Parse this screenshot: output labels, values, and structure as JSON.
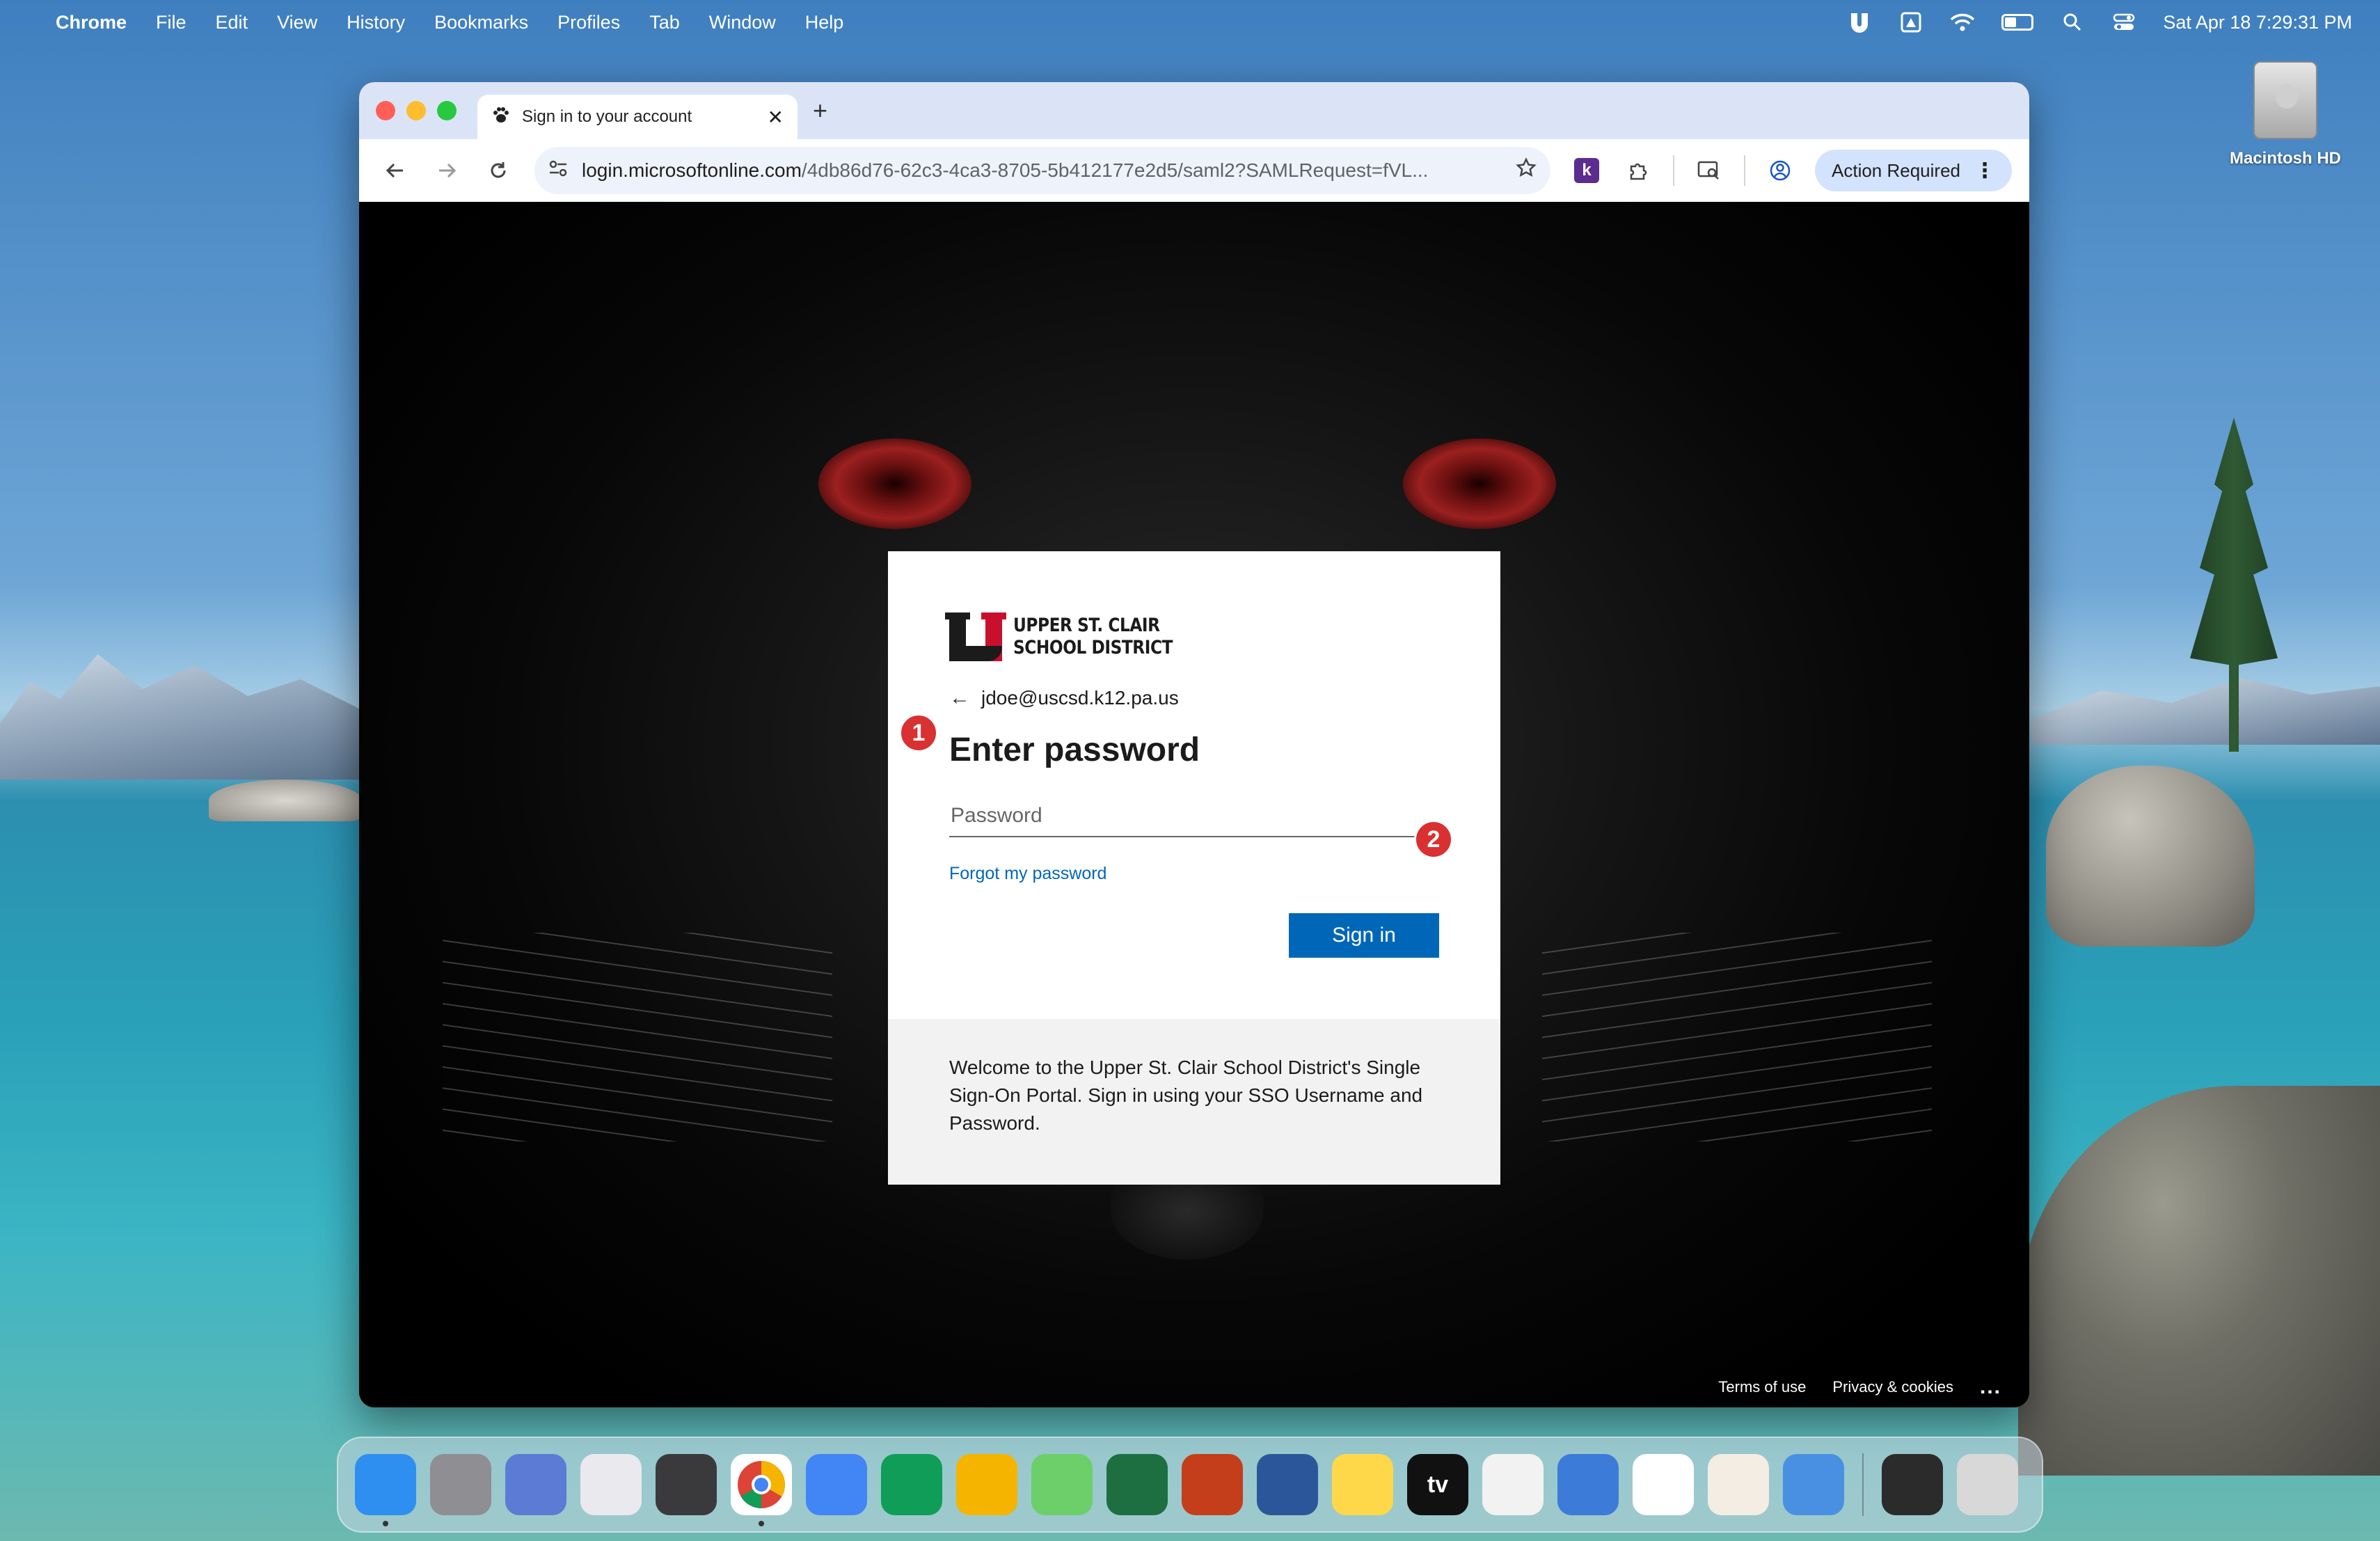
{
  "menubar": {
    "apple": "",
    "app_name": "Chrome",
    "items": [
      "File",
      "Edit",
      "View",
      "History",
      "Bookmarks",
      "Profiles",
      "Tab",
      "Window",
      "Help"
    ],
    "clock": "Sat Apr 18  7:29:31 PM",
    "status_icons": [
      "u-icon",
      "drive-icon",
      "wifi-icon",
      "battery-icon",
      "search-icon",
      "control-center-icon"
    ]
  },
  "desktop": {
    "hd_label": "Macintosh HD"
  },
  "browser": {
    "tab_title": "Sign in to your account",
    "tab_close": "✕",
    "new_tab": "+",
    "url_host": "login.microsoftonline.com",
    "url_path": "/4db86d76-62c3-4ca3-8705-5b412177e2d5/saml2?SAMLRequest=fVL...",
    "ext_k": "k",
    "action_required": "Action Required"
  },
  "signin": {
    "logo_line1": "UPPER ST. CLAIR",
    "logo_line2": "SCHOOL DISTRICT",
    "back_arrow": "←",
    "identity": "jdoe@uscsd.k12.pa.us",
    "heading": "Enter password",
    "password_placeholder": "Password",
    "forgot_link": "Forgot my password",
    "signin_button": "Sign in",
    "footer_text": "Welcome to the Upper St. Clair School District's Single Sign-On Portal. Sign in using your SSO Username and Password."
  },
  "annotations": {
    "badge_1": "1",
    "badge_2": "2"
  },
  "page_footer": {
    "terms": "Terms of use",
    "privacy": "Privacy & cookies",
    "more": "..."
  },
  "dock": {
    "apps": [
      {
        "name": "finder",
        "color": "#2f8ff0",
        "running": true
      },
      {
        "name": "system-settings",
        "color": "#8e8e93",
        "running": false
      },
      {
        "name": "iphone-mirroring",
        "color": "#5b7bd5",
        "running": false
      },
      {
        "name": "launchpad",
        "color": "#e9e9ee",
        "running": false
      },
      {
        "name": "calculator",
        "color": "#3a3a3c",
        "running": false
      },
      {
        "name": "chrome",
        "color": "#ffffff",
        "running": true
      },
      {
        "name": "google-docs",
        "color": "#4285f4",
        "running": false
      },
      {
        "name": "google-sheets",
        "color": "#0f9d58",
        "running": false
      },
      {
        "name": "google-slides",
        "color": "#f4b400",
        "running": false
      },
      {
        "name": "maps",
        "color": "#6ccf6a",
        "running": false
      },
      {
        "name": "excel",
        "color": "#1d6f42",
        "running": false
      },
      {
        "name": "powerpoint",
        "color": "#c43e1c",
        "running": false
      },
      {
        "name": "word",
        "color": "#2b579a",
        "running": false
      },
      {
        "name": "notes",
        "color": "#ffd84a",
        "running": false
      },
      {
        "name": "apple-tv",
        "color": "#111111",
        "running": false
      },
      {
        "name": "photos",
        "color": "#f2f2f2",
        "running": false
      },
      {
        "name": "drive-app",
        "color": "#3d7bd9",
        "running": false
      },
      {
        "name": "reminders",
        "color": "#ffffff",
        "running": false
      },
      {
        "name": "slack",
        "color": "#f4ede4",
        "running": false
      },
      {
        "name": "weather",
        "color": "#4a90e2",
        "running": false
      }
    ],
    "trailing": [
      {
        "name": "screenshot",
        "color": "#2b2b2b"
      },
      {
        "name": "trash",
        "color": "#d8d8d8"
      }
    ],
    "tv_label": "tv"
  }
}
